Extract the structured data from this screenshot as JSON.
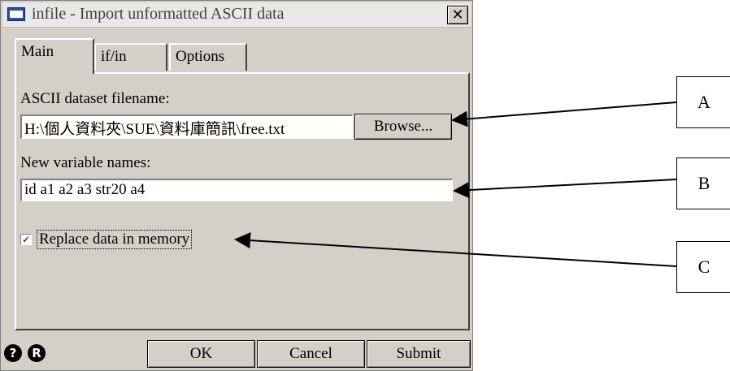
{
  "window": {
    "title": "infile - Import unformatted ASCII data",
    "close_symbol": "✕"
  },
  "tabs": [
    {
      "label": "Main",
      "active": true
    },
    {
      "label": "if/in",
      "active": false
    },
    {
      "label": "Options",
      "active": false
    }
  ],
  "main": {
    "filename_label": "ASCII dataset filename:",
    "filename_value": "H:\\個人資料夾\\SUE\\資料庫簡訊\\free.txt",
    "browse_label": "Browse...",
    "varnames_label": "New variable names:",
    "varnames_value": "id a1 a2 a3 str20 a4",
    "replace_label": "Replace data in memory",
    "replace_checked": true
  },
  "footer": {
    "help_icon": "?",
    "reset_icon": "R",
    "ok_label": "OK",
    "cancel_label": "Cancel",
    "submit_label": "Submit"
  },
  "callouts": {
    "a": "A",
    "b": "B",
    "c": "C"
  }
}
